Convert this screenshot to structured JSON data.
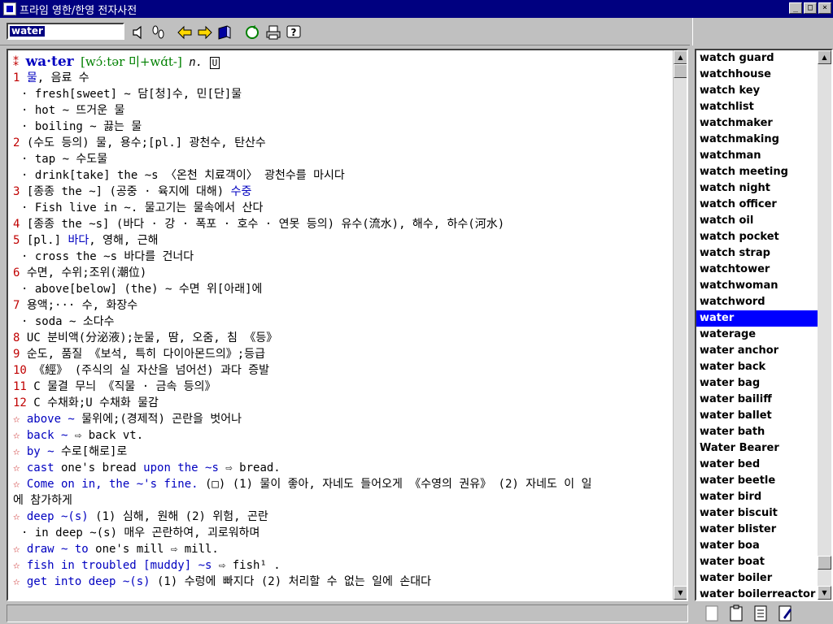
{
  "window": {
    "title": "프라임 영한/한영 전자사전",
    "minimize": "_",
    "maximize": "□",
    "close": "×"
  },
  "search": {
    "value": "water"
  },
  "entry": {
    "headword": "wa·ter",
    "pron": "[wɔ́ːtər 미+wɑ́t-]",
    "pos": "n.",
    "badge": "U",
    "lines": [
      {
        "num": "1",
        "text": " ",
        "blue": "물",
        "rest": ", 음료 수"
      },
      {
        "num": "",
        "text": "· fresh[sweet] ~ 담[청]수, 민[단]물",
        "indent": true
      },
      {
        "num": "",
        "text": "· hot ~ 뜨거운 물",
        "indent": true
      },
      {
        "num": "",
        "text": "· boiling ~ 끓는 물",
        "indent": true
      },
      {
        "num": "2",
        "text": " (수도 등의) 물, 용수;[pl.] 광천수, 탄산수"
      },
      {
        "num": "",
        "text": "· tap ~ 수도물",
        "indent": true
      },
      {
        "num": "",
        "text": "· drink[take] the ~s 〈온천 치료객이〉 광천수를 마시다",
        "indent": true
      },
      {
        "num": "3",
        "text": " [종종 the ~] (공중 · 육지에 대해) ",
        "blue": "수중"
      },
      {
        "num": "",
        "text": "· Fish live in ~. 물고기는 물속에서 산다",
        "indent": true
      },
      {
        "num": "4",
        "text": " [종종 the ~s] (바다 · 강 · 폭포 · 호수 · 연못 등의) 유수(流水), 해수, 하수(河水)"
      },
      {
        "num": "5",
        "text": " [pl.] ",
        "blue": "바다",
        "rest": ", 영해, 근해"
      },
      {
        "num": "",
        "text": "· cross the ~s 바다를 건너다",
        "indent": true
      },
      {
        "num": "6",
        "text": " 수면, 수위;조위(潮位)"
      },
      {
        "num": "",
        "text": "· above[below] (the) ~ 수면 위[아래]에",
        "indent": true
      },
      {
        "num": "7",
        "text": " 용액;··· 수, 화장수"
      },
      {
        "num": "",
        "text": "· soda ~ 소다수",
        "indent": true
      },
      {
        "num": "8",
        "text": "  UC  분비액(分泌液);눈물, 땀, 오줌, 침 《등》"
      },
      {
        "num": "9",
        "text": " 순도, 품질 《보석, 특히 다이아몬드의》;등급"
      },
      {
        "num": "10",
        "text": " 《經》 (주식의 실 자산을 넘어선) 과다 증발"
      },
      {
        "num": "11",
        "text": " C 물결 무늬 《직물 · 금속 등의》"
      },
      {
        "num": "12",
        "text": " C 수채화;U 수채화 물감"
      },
      {
        "star": true,
        "blue": "above ~",
        "rest": " 물위에;(경제적) 곤란을 벗어나"
      },
      {
        "star": true,
        "blue": "back ~",
        "rest": " ⇨ back vt."
      },
      {
        "star": true,
        "blue": "by ~",
        "rest": " 수로[해로]로"
      },
      {
        "star": true,
        "blue": "cast",
        "rest": " one's bread ",
        "blue2": "upon the ~s",
        "rest2": " ⇨ bread."
      },
      {
        "star": true,
        "blue": "Come on in, the ~'s fine.",
        "rest": " (□) (1) 물이 좋아, 자네도 들어오게 《수영의 권유》 (2) 자네도 이 일"
      },
      {
        "num": "",
        "text": "에 참가하게"
      },
      {
        "star": true,
        "blue": "deep ~(s)",
        "rest": " (1) 심해, 원해 (2) 위험, 곤란"
      },
      {
        "num": "",
        "text": "· in deep ~(s) 매우 곤란하여, 괴로워하며",
        "indent": true
      },
      {
        "star": true,
        "blue": "draw ~ to",
        "rest": " one's mill ⇨  mill."
      },
      {
        "star": true,
        "blue": "fish in troubled [muddy] ~s",
        "rest": " ⇨ fish¹ ."
      },
      {
        "star": true,
        "blue": " get into deep ~(s)",
        "rest": " (1) 수렁에 빠지다 (2) 처리할 수 없는 일에 손대다"
      }
    ]
  },
  "wordlist": [
    "watch guard",
    "watchhouse",
    "watch key",
    "watchlist",
    "watchmaker",
    "watchmaking",
    "watchman",
    "watch meeting",
    "watch night",
    "watch officer",
    "watch oil",
    "watch pocket",
    "watch strap",
    "watchtower",
    "watchwoman",
    "watchword",
    "water",
    "waterage",
    "water anchor",
    "water back",
    "water bag",
    "water bailiff",
    "water ballet",
    "water bath",
    "Water Bearer",
    "water bed",
    "water beetle",
    "water bird",
    "water biscuit",
    "water blister",
    "water boa",
    "water boat",
    "water boiler",
    "water boilerreactor"
  ],
  "selected_index": 16,
  "colors": {
    "titlebar": "#000080",
    "selection": "#0000ff",
    "headword": "#0000c0",
    "sense_number": "#c00000"
  },
  "icons": [
    "speaker-icon",
    "footprints-icon",
    "back-arrow-icon",
    "forward-arrow-icon",
    "book-icon",
    "refresh-icon",
    "print-icon",
    "help-icon"
  ]
}
